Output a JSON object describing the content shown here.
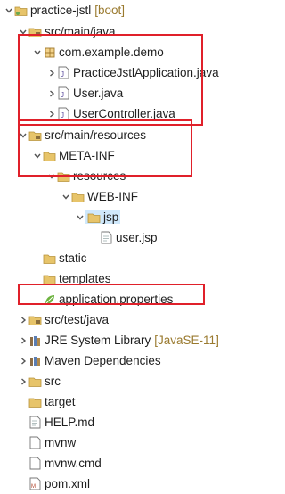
{
  "project": {
    "name": "practice-jstl",
    "decoration": "[boot]"
  },
  "nodes": {
    "src_main_java": {
      "label": "src/main/java"
    },
    "com_example_demo": {
      "label": "com.example.demo"
    },
    "practice_app": {
      "label": "PracticeJstlApplication.java"
    },
    "user_java": {
      "label": "User.java"
    },
    "user_controller": {
      "label": "UserController.java"
    },
    "src_main_resources": {
      "label": "src/main/resources"
    },
    "meta_inf": {
      "label": "META-INF"
    },
    "resources": {
      "label": "resources"
    },
    "web_inf": {
      "label": "WEB-INF"
    },
    "jsp": {
      "label": "jsp"
    },
    "user_jsp": {
      "label": "user.jsp"
    },
    "static": {
      "label": "static"
    },
    "templates": {
      "label": "templates"
    },
    "app_properties": {
      "label": "application.properties"
    },
    "src_test_java": {
      "label": "src/test/java"
    },
    "jre": {
      "label": "JRE System Library",
      "decoration": "[JavaSE-11]"
    },
    "maven": {
      "label": "Maven Dependencies"
    },
    "src": {
      "label": "src"
    },
    "target": {
      "label": "target"
    },
    "help": {
      "label": "HELP.md"
    },
    "mvnw": {
      "label": "mvnw"
    },
    "mvnw_cmd": {
      "label": "mvnw.cmd"
    },
    "pom": {
      "label": "pom.xml"
    }
  },
  "colors": {
    "highlight": "#e0202a",
    "selection": "#cfe8fb",
    "decoration": "#9a7a2f"
  }
}
